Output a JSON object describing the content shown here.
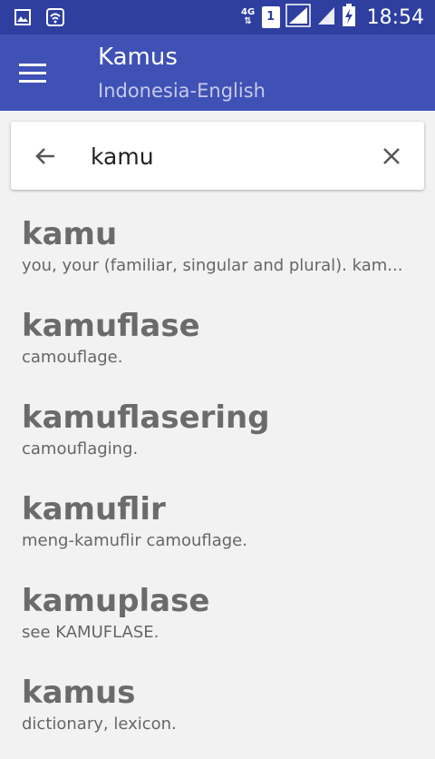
{
  "status_bar": {
    "left_icons": [
      "image-icon",
      "wifi-icon"
    ],
    "network_label": "4G",
    "sim_label": "1",
    "time": "18:54"
  },
  "app_bar": {
    "title": "Kamus",
    "subtitle": "Indonesia-English",
    "color": "#3f51b5"
  },
  "search": {
    "value": "kamu",
    "back_icon": "arrow-left-icon",
    "clear_icon": "close-icon"
  },
  "results": [
    {
      "word": "kamu",
      "definition": "you, your (familiar, singular and plural).  kam..."
    },
    {
      "word": "kamuflase",
      "definition": "camouflage."
    },
    {
      "word": "kamuflasering",
      "definition": "camouflaging."
    },
    {
      "word": "kamuflir",
      "definition": "meng-kamuflir camouflage."
    },
    {
      "word": "kamuplase",
      "definition": "see  KAMUFLASE."
    },
    {
      "word": "kamus",
      "definition": "dictionary, lexicon."
    }
  ]
}
